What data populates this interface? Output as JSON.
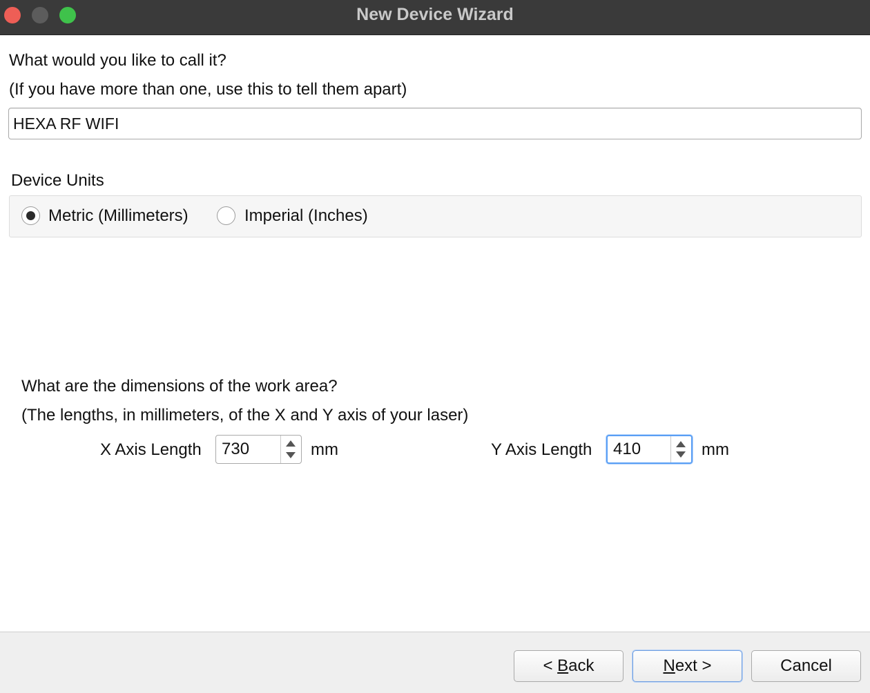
{
  "window": {
    "title": "New Device Wizard"
  },
  "name_section": {
    "prompt": "What would you like to call it?",
    "hint": "(If you have more than one, use this to tell them apart)",
    "device_name": "HEXA RF WIFI"
  },
  "units_section": {
    "label": "Device Units",
    "options": [
      {
        "label": "Metric (Millimeters)",
        "selected": true
      },
      {
        "label": "Imperial (Inches)",
        "selected": false
      }
    ]
  },
  "dimensions_section": {
    "prompt": "What are the dimensions of the work area?",
    "hint": "(The lengths, in millimeters, of the X and Y axis of your laser)",
    "x_axis": {
      "label": "X Axis Length",
      "value": "730",
      "unit": "mm"
    },
    "y_axis": {
      "label": "Y Axis Length",
      "value": "410",
      "unit": "mm"
    }
  },
  "footer": {
    "back": {
      "prefix": "< ",
      "mnemonic": "B",
      "rest": "ack"
    },
    "next": {
      "mnemonic": "N",
      "rest": "ext >"
    },
    "cancel": "Cancel"
  }
}
